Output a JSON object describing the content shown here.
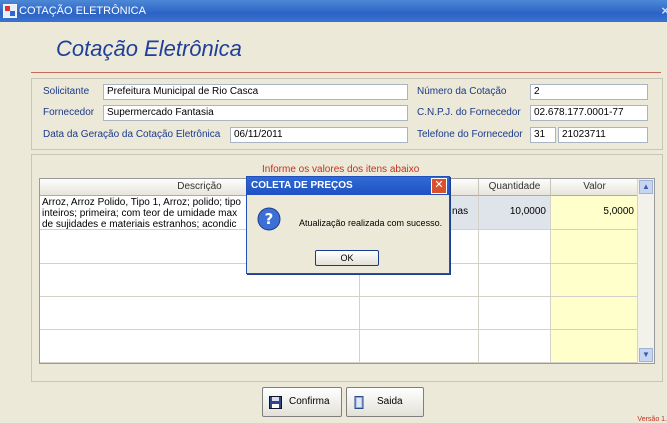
{
  "window": {
    "title": "COTAÇÃO ELETRÔNICA"
  },
  "form": {
    "title": "Cotação Eletrônica",
    "solicitante_label": "Solicitante",
    "solicitante": "Prefeitura Municipal de Rio Casca",
    "fornecedor_label": "Fornecedor",
    "fornecedor": "Supermercado Fantasia",
    "data_label": "Data da Geração da Cotação Eletrônica",
    "data": "06/11/2011",
    "numero_label": "Número da Cotação",
    "numero": "2",
    "cnpj_label": "C.N.P.J. do Fornecedor",
    "cnpj": "02.678.177.0001-77",
    "telefone_label": "Telefone do Fornecedor",
    "telefone_ddd": "31",
    "telefone": "21023711"
  },
  "items": {
    "instruction": "Informe os valores dos itens abaixo",
    "headers": [
      "Descrição",
      "Quantidade",
      "Valor"
    ],
    "rows": [
      {
        "descricao_l1": "Arroz, Arroz Polido, Tipo 1, Arroz; polido; tipo",
        "descricao_l2": "inteiros; primeira; com teor de umidade max",
        "descricao_l3": "de sujidades e materiais estranhos; acondic",
        "unidade_fragment": "nas",
        "quantidade": "10,0000",
        "valor": "5,0000"
      }
    ]
  },
  "buttons": {
    "confirma": "Confirma",
    "saida": "Saida"
  },
  "footer": {
    "version": "Versão 1."
  },
  "dialog": {
    "title": "COLETA DE PREÇOS",
    "close": "✕",
    "message": "Atualização realizada com sucesso.",
    "ok": "OK"
  },
  "colors": {
    "accent": "#1f3f98",
    "titlebar": "#2c63c5",
    "valor_bg": "#ffffcc",
    "instruction": "#c2331f"
  }
}
